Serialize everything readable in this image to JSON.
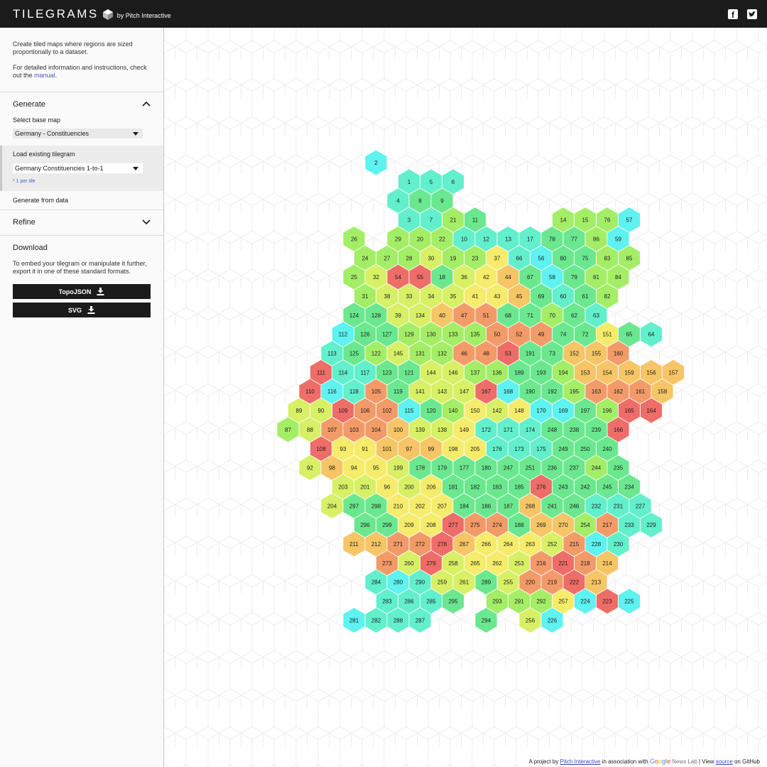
{
  "header": {
    "logo_text": "TILEGRAMS",
    "byline": "by Pitch Interactive",
    "icons": [
      "cube-icon",
      "facebook-icon",
      "twitter-icon"
    ]
  },
  "sidebar": {
    "intro_1": "Create tiled maps where regions are sized proportionally to a dataset.",
    "intro_2_prefix": "For detailed information and instructions, check out the",
    "intro_2_link": "manual",
    "intro_2_suffix": ".",
    "generate": {
      "title": "Generate",
      "base_map_label": "Select base map",
      "base_map_value": "Germany - Constituencies",
      "load_label": "Load existing tilegram",
      "load_value": "Germany Constituencies 1-to-1",
      "per_tile_note": "* 1 per tile",
      "from_data_label": "Generate from data"
    },
    "refine": {
      "title": "Refine"
    },
    "download": {
      "title": "Download",
      "description": "To embed your tilegram or manipulate it further, export it in one of these standard formats.",
      "buttons": [
        "TopoJSON",
        "SVG"
      ]
    }
  },
  "colors": {
    "topbar": "#1b1b1b",
    "link": "#4a58c7",
    "scale": [
      "#5ef2f0",
      "#62efcc",
      "#6be88f",
      "#a4ee67",
      "#d8f065",
      "#f6ec6b",
      "#f6c566",
      "#f39b68",
      "#ef6d68"
    ]
  },
  "tilegram": {
    "rows": [
      {
        "start": 5,
        "tiles": [
          [
            2,
            0
          ]
        ]
      },
      {
        "start": 6,
        "tiles": [
          [
            1,
            1
          ],
          [
            5,
            1
          ],
          [
            6,
            1
          ]
        ]
      },
      {
        "start": 6,
        "tiles": [
          [
            4,
            1
          ],
          [
            8,
            2
          ],
          [
            9,
            2
          ]
        ]
      },
      {
        "start": 6,
        "tiles": [
          [
            3,
            1
          ],
          [
            7,
            1
          ],
          [
            21,
            3
          ],
          [
            11,
            2
          ],
          null,
          null,
          null,
          [
            14,
            3
          ],
          [
            15,
            3
          ],
          [
            76,
            3
          ],
          [
            57,
            0
          ]
        ]
      },
      {
        "start": 4,
        "tiles": [
          [
            26,
            3
          ],
          null,
          [
            29,
            3
          ],
          [
            20,
            3
          ],
          [
            22,
            3
          ],
          [
            10,
            1
          ],
          [
            12,
            1
          ],
          [
            13,
            1
          ],
          [
            17,
            1
          ],
          [
            78,
            2
          ],
          [
            77,
            2
          ],
          [
            86,
            3
          ],
          [
            59,
            0
          ]
        ]
      },
      {
        "start": 4,
        "tiles": [
          [
            24,
            3
          ],
          [
            27,
            3
          ],
          [
            28,
            3
          ],
          [
            30,
            4
          ],
          [
            19,
            3
          ],
          [
            23,
            3
          ],
          [
            37,
            5
          ],
          [
            66,
            1
          ],
          [
            56,
            0
          ],
          [
            80,
            2
          ],
          [
            75,
            2
          ],
          [
            83,
            3
          ],
          [
            85,
            3
          ]
        ]
      },
      {
        "start": 4,
        "tiles": [
          [
            25,
            3
          ],
          [
            32,
            4
          ],
          [
            54,
            8
          ],
          [
            55,
            8
          ],
          [
            18,
            2
          ],
          [
            36,
            4
          ],
          [
            42,
            5
          ],
          [
            44,
            6
          ],
          [
            67,
            2
          ],
          [
            58,
            0
          ],
          [
            79,
            2
          ],
          [
            81,
            3
          ],
          [
            84,
            3
          ]
        ]
      },
      {
        "start": 4,
        "tiles": [
          [
            31,
            3
          ],
          [
            38,
            4
          ],
          [
            33,
            4
          ],
          [
            34,
            4
          ],
          [
            35,
            4
          ],
          [
            41,
            5
          ],
          [
            43,
            5
          ],
          [
            45,
            6
          ],
          [
            69,
            2
          ],
          [
            60,
            1
          ],
          [
            61,
            2
          ],
          [
            82,
            3
          ]
        ]
      },
      {
        "start": 4,
        "tiles": [
          [
            124,
            2
          ],
          [
            128,
            2
          ],
          [
            39,
            4
          ],
          [
            134,
            4
          ],
          [
            40,
            6
          ],
          [
            47,
            7
          ],
          [
            51,
            7
          ],
          [
            68,
            2
          ],
          [
            71,
            2
          ],
          [
            70,
            3
          ],
          [
            62,
            2
          ],
          [
            63,
            1
          ]
        ]
      },
      {
        "start": 3,
        "tiles": [
          [
            112,
            0
          ],
          [
            126,
            2
          ],
          [
            127,
            2
          ],
          [
            129,
            3
          ],
          [
            130,
            3
          ],
          [
            133,
            3
          ],
          [
            135,
            3
          ],
          [
            50,
            7
          ],
          [
            52,
            7
          ],
          [
            49,
            7
          ],
          [
            74,
            2
          ],
          [
            72,
            2
          ],
          [
            151,
            5
          ],
          [
            65,
            2
          ],
          [
            64,
            1
          ]
        ]
      },
      {
        "start": 3,
        "tiles": [
          [
            113,
            1
          ],
          [
            125,
            2
          ],
          [
            122,
            3
          ],
          [
            145,
            4
          ],
          [
            131,
            3
          ],
          [
            132,
            3
          ],
          [
            46,
            7
          ],
          [
            48,
            7
          ],
          [
            53,
            8
          ],
          [
            191,
            2
          ],
          [
            73,
            2
          ],
          [
            152,
            6
          ],
          [
            155,
            6
          ],
          [
            160,
            7
          ]
        ]
      },
      {
        "start": 2,
        "tiles": [
          [
            111,
            8
          ],
          [
            114,
            1
          ],
          [
            117,
            1
          ],
          [
            123,
            2
          ],
          [
            121,
            2
          ],
          [
            144,
            4
          ],
          [
            146,
            4
          ],
          [
            137,
            3
          ],
          [
            136,
            3
          ],
          [
            189,
            2
          ],
          [
            193,
            2
          ],
          [
            194,
            3
          ],
          [
            153,
            6
          ],
          [
            154,
            6
          ],
          [
            159,
            6
          ],
          [
            156,
            6
          ],
          [
            157,
            6
          ]
        ]
      },
      {
        "start": 2,
        "tiles": [
          [
            110,
            8
          ],
          [
            116,
            0
          ],
          [
            118,
            1
          ],
          [
            105,
            7
          ],
          [
            119,
            2
          ],
          [
            141,
            4
          ],
          [
            143,
            4
          ],
          [
            147,
            4
          ],
          [
            167,
            8
          ],
          [
            168,
            0
          ],
          [
            190,
            2
          ],
          [
            192,
            2
          ],
          [
            195,
            3
          ],
          [
            163,
            7
          ],
          [
            162,
            7
          ],
          [
            161,
            7
          ],
          [
            158,
            6
          ]
        ]
      },
      {
        "start": 1,
        "tiles": [
          [
            89,
            4
          ],
          [
            90,
            4
          ],
          [
            109,
            8
          ],
          [
            106,
            7
          ],
          [
            102,
            7
          ],
          [
            115,
            0
          ],
          [
            120,
            2
          ],
          [
            140,
            3
          ],
          [
            150,
            5
          ],
          [
            142,
            4
          ],
          [
            148,
            5
          ],
          [
            170,
            0
          ],
          [
            169,
            0
          ],
          [
            197,
            2
          ],
          [
            196,
            3
          ],
          [
            165,
            8
          ],
          [
            164,
            8
          ]
        ]
      },
      {
        "start": 1,
        "tiles": [
          [
            87,
            3
          ],
          [
            88,
            4
          ],
          [
            107,
            7
          ],
          [
            103,
            7
          ],
          [
            104,
            7
          ],
          [
            100,
            6
          ],
          [
            139,
            4
          ],
          [
            138,
            4
          ],
          [
            149,
            5
          ],
          [
            172,
            1
          ],
          [
            171,
            1
          ],
          [
            174,
            1
          ],
          [
            248,
            2
          ],
          [
            238,
            2
          ],
          [
            239,
            2
          ],
          [
            166,
            8
          ]
        ]
      },
      {
        "start": 2,
        "tiles": [
          [
            108,
            8
          ],
          [
            93,
            5
          ],
          [
            91,
            5
          ],
          [
            101,
            6
          ],
          [
            97,
            6
          ],
          [
            99,
            6
          ],
          [
            198,
            5
          ],
          [
            205,
            5
          ],
          [
            176,
            1
          ],
          [
            173,
            1
          ],
          [
            175,
            1
          ],
          [
            249,
            2
          ],
          [
            250,
            2
          ],
          [
            240,
            2
          ]
        ]
      },
      {
        "start": 2,
        "tiles": [
          [
            92,
            4
          ],
          [
            98,
            6
          ],
          [
            94,
            5
          ],
          [
            95,
            5
          ],
          [
            199,
            4
          ],
          [
            178,
            2
          ],
          [
            179,
            2
          ],
          [
            177,
            2
          ],
          [
            180,
            2
          ],
          [
            247,
            2
          ],
          [
            251,
            2
          ],
          [
            236,
            2
          ],
          [
            237,
            2
          ],
          [
            244,
            3
          ],
          [
            235,
            2
          ]
        ]
      },
      {
        "start": 3,
        "tiles": [
          [
            203,
            4
          ],
          [
            201,
            4
          ],
          [
            96,
            5
          ],
          [
            200,
            4
          ],
          [
            206,
            5
          ],
          [
            181,
            2
          ],
          [
            182,
            2
          ],
          [
            183,
            2
          ],
          [
            185,
            2
          ],
          [
            276,
            8
          ],
          [
            243,
            2
          ],
          [
            242,
            2
          ],
          [
            245,
            2
          ],
          [
            234,
            2
          ]
        ]
      },
      {
        "start": 3,
        "tiles": [
          [
            204,
            4
          ],
          [
            297,
            2
          ],
          [
            298,
            2
          ],
          [
            210,
            5
          ],
          [
            202,
            5
          ],
          [
            207,
            5
          ],
          [
            184,
            2
          ],
          [
            186,
            2
          ],
          [
            187,
            2
          ],
          [
            268,
            6
          ],
          [
            241,
            2
          ],
          [
            246,
            2
          ],
          [
            232,
            1
          ],
          [
            231,
            1
          ],
          [
            227,
            1
          ]
        ]
      },
      {
        "start": 4,
        "tiles": [
          [
            296,
            2
          ],
          [
            299,
            2
          ],
          [
            209,
            5
          ],
          [
            208,
            5
          ],
          [
            277,
            8
          ],
          [
            275,
            7
          ],
          [
            274,
            7
          ],
          [
            188,
            2
          ],
          [
            269,
            6
          ],
          [
            270,
            6
          ],
          [
            254,
            3
          ],
          [
            217,
            7
          ],
          [
            233,
            1
          ],
          [
            229,
            1
          ]
        ]
      },
      {
        "start": 4,
        "tiles": [
          [
            211,
            6
          ],
          [
            212,
            6
          ],
          [
            271,
            7
          ],
          [
            272,
            7
          ],
          [
            278,
            8
          ],
          [
            267,
            6
          ],
          [
            266,
            5
          ],
          [
            264,
            5
          ],
          [
            263,
            5
          ],
          [
            252,
            4
          ],
          [
            215,
            7
          ],
          [
            228,
            0
          ],
          [
            230,
            1
          ]
        ]
      },
      {
        "start": 5,
        "tiles": [
          [
            273,
            7
          ],
          [
            260,
            4
          ],
          [
            279,
            8
          ],
          [
            258,
            4
          ],
          [
            265,
            5
          ],
          [
            262,
            5
          ],
          [
            253,
            4
          ],
          [
            216,
            7
          ],
          [
            221,
            8
          ],
          [
            218,
            7
          ],
          [
            214,
            6
          ]
        ]
      },
      {
        "start": 5,
        "tiles": [
          [
            284,
            1
          ],
          [
            280,
            0
          ],
          [
            290,
            1
          ],
          [
            259,
            4
          ],
          [
            261,
            4
          ],
          [
            289,
            2
          ],
          [
            255,
            4
          ],
          [
            220,
            7
          ],
          [
            219,
            7
          ],
          [
            222,
            8
          ],
          [
            213,
            6
          ]
        ]
      },
      {
        "start": 5,
        "tiles": [
          [
            283,
            1
          ],
          [
            286,
            1
          ],
          [
            285,
            1
          ],
          [
            295,
            2
          ],
          null,
          [
            293,
            3
          ],
          [
            291,
            3
          ],
          [
            292,
            3
          ],
          [
            257,
            5
          ],
          [
            224,
            0
          ],
          [
            223,
            8
          ],
          [
            225,
            0
          ]
        ]
      },
      {
        "start": 4,
        "tiles": [
          [
            281,
            0
          ],
          [
            282,
            1
          ],
          [
            288,
            1
          ],
          [
            287,
            1
          ],
          null,
          null,
          [
            294,
            2
          ],
          null,
          [
            256,
            4
          ],
          [
            226,
            0
          ]
        ]
      }
    ]
  }
}
